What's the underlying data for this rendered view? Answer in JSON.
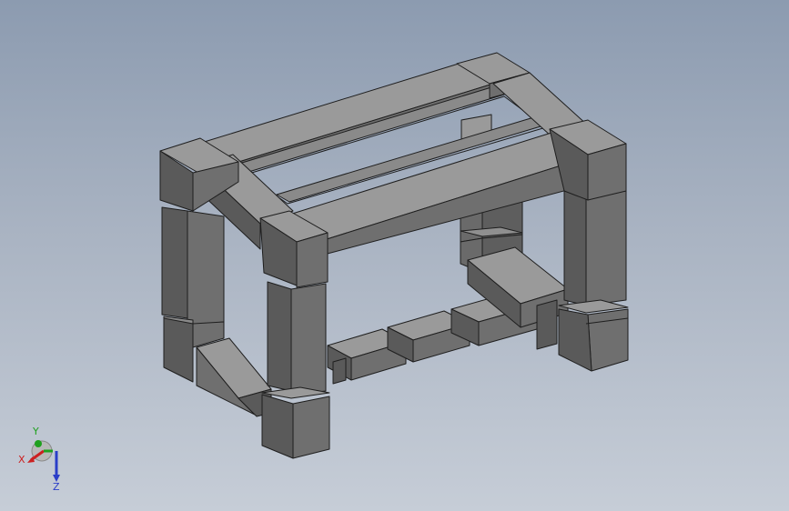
{
  "viewport": {
    "background_top": "#8c9bb0",
    "background_bottom": "#c6cdd7"
  },
  "model": {
    "face_top": "#9a9a9a",
    "face_front": "#6f6f6f",
    "face_side": "#5a5a5a",
    "edge": "#1e1e1e"
  },
  "triad": {
    "x_label": "X",
    "y_label": "Y",
    "z_label": "Z",
    "x_color": "#cc2020",
    "y_color": "#1fa01f",
    "z_color": "#2a3ec8"
  }
}
